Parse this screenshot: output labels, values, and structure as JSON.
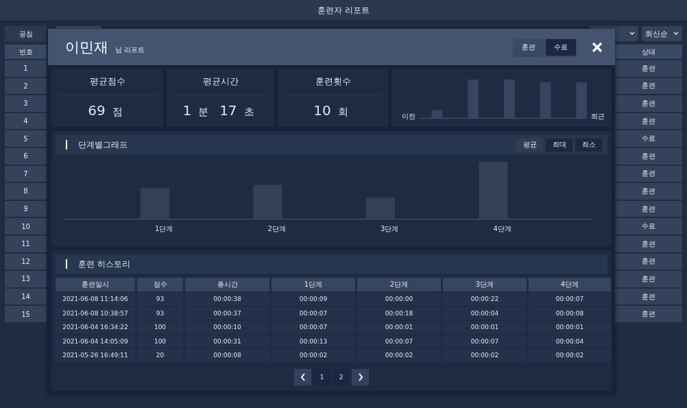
{
  "window": {
    "title": "훈련자 리포트"
  },
  "left_panel": {
    "button": "공침",
    "header": "번호",
    "rows": [
      "1",
      "2",
      "3",
      "4",
      "5",
      "6",
      "7",
      "8",
      "9",
      "10",
      "11",
      "12",
      "13",
      "14",
      "15"
    ]
  },
  "right_panel": {
    "sort": "최신순",
    "header": "상태",
    "rows": [
      "훈련",
      "훈련",
      "훈련",
      "훈련",
      "수료",
      "훈련",
      "훈련",
      "훈련",
      "훈련",
      "수료",
      "훈련",
      "훈련",
      "훈련",
      "훈련",
      "훈련"
    ]
  },
  "modal": {
    "name": "이민재",
    "subtitle": "님 리포트",
    "filters": [
      {
        "label": "훈련",
        "selected": false
      },
      {
        "label": "수료",
        "selected": true
      }
    ],
    "stats": [
      {
        "label": "평균점수",
        "parts": [
          {
            "value": "69",
            "unit": "점"
          }
        ]
      },
      {
        "label": "평균시간",
        "parts": [
          {
            "value": "1",
            "unit": "분"
          },
          {
            "value": "17",
            "unit": "초"
          }
        ]
      },
      {
        "label": "훈련횟수",
        "parts": [
          {
            "value": "10",
            "unit": "회"
          }
        ]
      }
    ],
    "trend": {
      "start_label": "이전",
      "end_label": "최근"
    },
    "stage_graph": {
      "title": "단계별그래프",
      "modes": [
        {
          "label": "평균",
          "selected": true
        },
        {
          "label": "최대",
          "selected": false
        },
        {
          "label": "최소",
          "selected": false
        }
      ],
      "categories": [
        "1단계",
        "2단계",
        "3단계",
        "4단계"
      ]
    },
    "history": {
      "title": "훈련 히스토리",
      "columns": [
        "훈련일시",
        "점수",
        "총시간",
        "1단계",
        "2단계",
        "3단계",
        "4단계"
      ],
      "rows": [
        [
          "2021-06-08 11:14:06",
          "93",
          "00:00:38",
          "00:00:09",
          "00:00:00",
          "00:00:22",
          "00:00:07"
        ],
        [
          "2021-06-08 10:38:57",
          "93",
          "00:00:37",
          "00:00:07",
          "00:00:18",
          "00:00:04",
          "00:00:08"
        ],
        [
          "2021-06-04 16:34:22",
          "100",
          "00:00:10",
          "00:00:07",
          "00:00:01",
          "00:00:01",
          "00:00:01"
        ],
        [
          "2021-06-04 14:05:09",
          "100",
          "00:00:31",
          "00:00:13",
          "00:00:07",
          "00:00:07",
          "00:00:04"
        ],
        [
          "2021-05-26 16:49:11",
          "20",
          "00:00:08",
          "00:00:02",
          "00:00:02",
          "00:00:02",
          "00:00:02"
        ]
      ],
      "pages": [
        "1",
        "2"
      ]
    }
  }
}
